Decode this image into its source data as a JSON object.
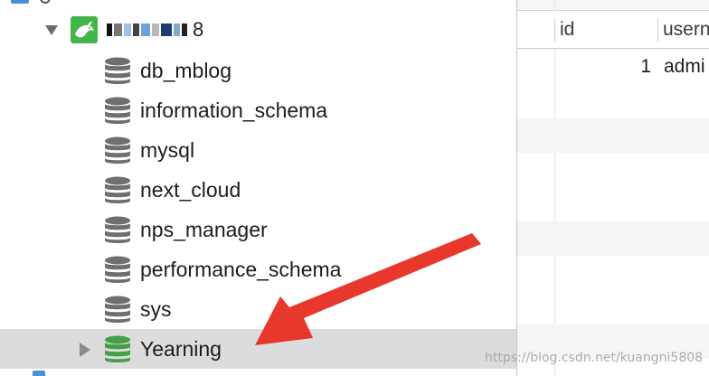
{
  "tree": {
    "connection": {
      "name_fragment": "8",
      "name_obscured": true,
      "icon": "mysql-dolphin-icon",
      "expanded": true
    },
    "databases": [
      {
        "label": "db_mblog",
        "icon": "database-icon"
      },
      {
        "label": "information_schema",
        "icon": "database-icon"
      },
      {
        "label": "mysql",
        "icon": "database-icon"
      },
      {
        "label": "next_cloud",
        "icon": "database-icon"
      },
      {
        "label": "nps_manager",
        "icon": "database-icon"
      },
      {
        "label": "performance_schema",
        "icon": "database-icon"
      },
      {
        "label": "sys",
        "icon": "database-icon"
      },
      {
        "label": "Yearning",
        "icon": "database-icon",
        "selected": true,
        "expanded": false,
        "color": "#43a047"
      }
    ]
  },
  "grid": {
    "columns": [
      {
        "label": "id"
      },
      {
        "label": "usern"
      }
    ],
    "rows": [
      {
        "id": "1",
        "username": "admi"
      }
    ]
  },
  "annotation": {
    "arrow_color": "#e8372b",
    "points_to": "Yearning"
  },
  "watermark": "https://blog.csdn.net/kuangni5808",
  "colors": {
    "selected_row": "#dcdcdc",
    "db_icon_gray": "#6f6f6f",
    "db_icon_green": "#43a047",
    "connection_icon": "#41b649"
  }
}
